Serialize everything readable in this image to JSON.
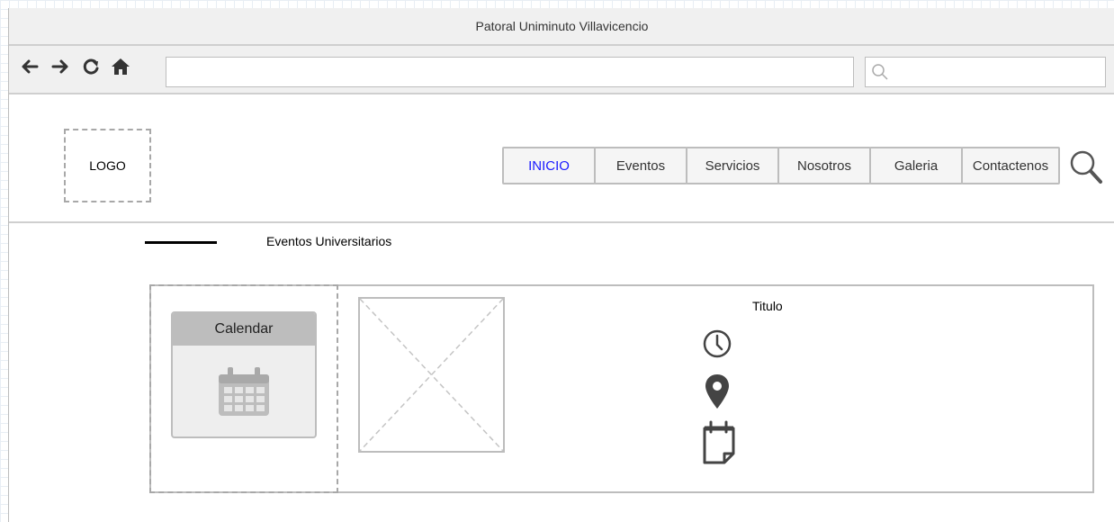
{
  "window": {
    "title": "Patoral Uniminuto Villavicencio"
  },
  "toolbar": {
    "address_value": "",
    "search_value": "",
    "icons": [
      "back-arrow-icon",
      "forward-arrow-icon",
      "reload-icon",
      "home-icon",
      "search-icon"
    ]
  },
  "header": {
    "logo_text": "LOGO",
    "nav": {
      "inicio": "INICIO",
      "eventos": "Eventos",
      "servicios": "Servicios",
      "nosotros": "Nosotros",
      "galeria": "Galeria",
      "contactenos": "Contactenos"
    },
    "active_color": "#1a1aff"
  },
  "section": {
    "title": "Eventos Universitarios"
  },
  "event": {
    "calendar_label": "Calendar",
    "title": "Titulo",
    "detail_icons": [
      "clock-icon",
      "location-pin-icon",
      "note-icon"
    ]
  }
}
